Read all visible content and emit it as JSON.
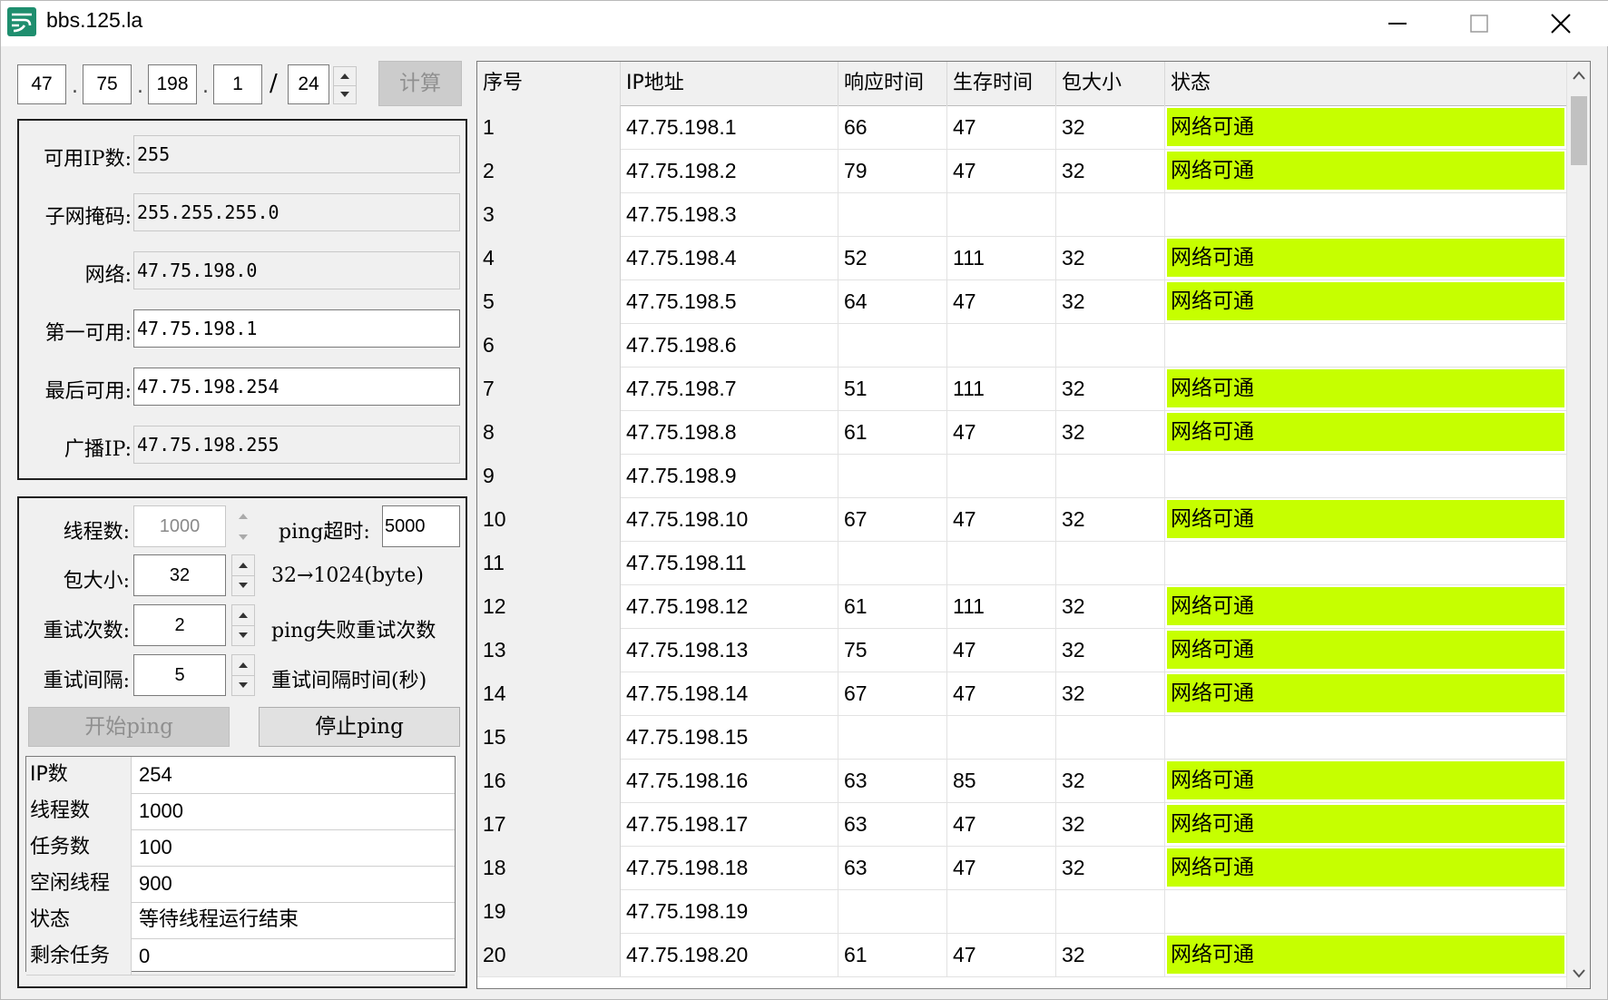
{
  "window": {
    "title": "bbs.125.la"
  },
  "ip_input": {
    "octets": [
      "47",
      "75",
      "198",
      "1"
    ],
    "mask_bits": "24",
    "calc_label": "计算"
  },
  "subnet_info": {
    "available_ip": {
      "label": "可用IP数:",
      "value": "255"
    },
    "netmask": {
      "label": "子网掩码:",
      "value": "255.255.255.0"
    },
    "network": {
      "label": "网络:",
      "value": "47.75.198.0"
    },
    "first_usable": {
      "label": "第一可用:",
      "value": "47.75.198.1"
    },
    "last_usable": {
      "label": "最后可用:",
      "value": "47.75.198.254"
    },
    "broadcast": {
      "label": "广播IP:",
      "value": "47.75.198.255"
    }
  },
  "ping_settings": {
    "threads": {
      "label": "线程数:",
      "value": "1000"
    },
    "timeout": {
      "label": "ping超时:",
      "value": "5000"
    },
    "packet_size": {
      "label": "包大小:",
      "value": "32",
      "hint": "32→1024(byte)"
    },
    "retry_count": {
      "label": "重试次数:",
      "value": "2",
      "hint": "ping失败重试次数"
    },
    "retry_interval": {
      "label": "重试间隔:",
      "value": "5",
      "hint": "重试间隔时间(秒)"
    },
    "start_label": "开始ping",
    "stop_label": "停止ping"
  },
  "status_table": [
    {
      "key": "IP数",
      "value": "254"
    },
    {
      "key": "线程数",
      "value": "1000"
    },
    {
      "key": "任务数",
      "value": "100"
    },
    {
      "key": "空闲线程",
      "value": "900"
    },
    {
      "key": "状态",
      "value": "等待线程运行结束"
    },
    {
      "key": "剩余任务",
      "value": "0"
    }
  ],
  "results": {
    "columns": [
      "序号",
      "IP地址",
      "响应时间",
      "生存时间",
      "包大小",
      "状态"
    ],
    "ok_color": "#c6ff00",
    "rows": [
      [
        "1",
        "47.75.198.1",
        "66",
        "47",
        "32",
        "网络可通"
      ],
      [
        "2",
        "47.75.198.2",
        "79",
        "47",
        "32",
        "网络可通"
      ],
      [
        "3",
        "47.75.198.3",
        "",
        "",
        "",
        ""
      ],
      [
        "4",
        "47.75.198.4",
        "52",
        "111",
        "32",
        "网络可通"
      ],
      [
        "5",
        "47.75.198.5",
        "64",
        "47",
        "32",
        "网络可通"
      ],
      [
        "6",
        "47.75.198.6",
        "",
        "",
        "",
        ""
      ],
      [
        "7",
        "47.75.198.7",
        "51",
        "111",
        "32",
        "网络可通"
      ],
      [
        "8",
        "47.75.198.8",
        "61",
        "47",
        "32",
        "网络可通"
      ],
      [
        "9",
        "47.75.198.9",
        "",
        "",
        "",
        ""
      ],
      [
        "10",
        "47.75.198.10",
        "67",
        "47",
        "32",
        "网络可通"
      ],
      [
        "11",
        "47.75.198.11",
        "",
        "",
        "",
        ""
      ],
      [
        "12",
        "47.75.198.12",
        "61",
        "111",
        "32",
        "网络可通"
      ],
      [
        "13",
        "47.75.198.13",
        "75",
        "47",
        "32",
        "网络可通"
      ],
      [
        "14",
        "47.75.198.14",
        "67",
        "47",
        "32",
        "网络可通"
      ],
      [
        "15",
        "47.75.198.15",
        "",
        "",
        "",
        ""
      ],
      [
        "16",
        "47.75.198.16",
        "63",
        "85",
        "32",
        "网络可通"
      ],
      [
        "17",
        "47.75.198.17",
        "63",
        "47",
        "32",
        "网络可通"
      ],
      [
        "18",
        "47.75.198.18",
        "63",
        "47",
        "32",
        "网络可通"
      ],
      [
        "19",
        "47.75.198.19",
        "",
        "",
        "",
        ""
      ],
      [
        "20",
        "47.75.198.20",
        "61",
        "47",
        "32",
        "网络可通"
      ]
    ]
  }
}
